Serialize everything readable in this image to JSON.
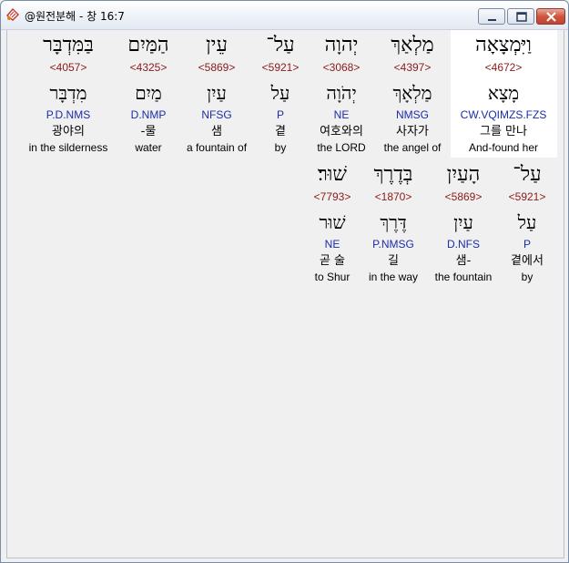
{
  "window": {
    "title": "@원전분해 - 창 16:7"
  },
  "rows": [
    {
      "words": [
        {
          "heb": "וַיִּמְצָאָה",
          "strong": "<4672>",
          "lemma": "מָצָא",
          "morph": "CW.VQIMZS.FZS",
          "kor": "그를 만나",
          "eng": "And-found her"
        },
        {
          "heb": "מַלְאַךְ",
          "strong": "<4397>",
          "lemma": "מַלְאָךְ",
          "morph": "NMSG",
          "kor": "사자가",
          "eng": "the angel of"
        },
        {
          "heb": "יְהוָה",
          "strong": "<3068>",
          "lemma": "יְהֹוָה",
          "morph": "NE",
          "kor": "여호와의",
          "eng": "the LORD"
        },
        {
          "heb": "עַל־",
          "strong": "<5921>",
          "lemma": "עַל",
          "morph": "P",
          "kor": "곁",
          "eng": "by"
        },
        {
          "heb": "עֵין",
          "strong": "<5869>",
          "lemma": "עַיִן",
          "morph": "NFSG",
          "kor": "샘",
          "eng": "a fountain of"
        },
        {
          "heb": "הַמַּיִם",
          "strong": "<4325>",
          "lemma": "מַיִם",
          "morph": "D.NMP",
          "kor": "-물",
          "eng": "water"
        },
        {
          "heb": "בַּמִּדְבָּר",
          "strong": "<4057>",
          "lemma": "מִדְבָּר",
          "morph": "P.D.NMS",
          "kor": "광야의",
          "eng": "in the silderness"
        }
      ]
    },
    {
      "words": [
        {
          "heb": "עַל־",
          "strong": "<5921>",
          "lemma": "עַל",
          "morph": "P",
          "kor": "곁에서",
          "eng": "by"
        },
        {
          "heb": "הָעַיִן",
          "strong": "<5869>",
          "lemma": "עַיִן",
          "morph": "D.NFS",
          "kor": "샘-",
          "eng": "the fountain"
        },
        {
          "heb": "בְּדֶרֶךְ",
          "strong": "<1870>",
          "lemma": "דֶּרֶךְ",
          "morph": "P.NMSG",
          "kor": "길",
          "eng": "in the way"
        },
        {
          "heb": "שׁוּר׃",
          "strong": "<7793>",
          "lemma": "שׁוּר",
          "morph": "NE",
          "kor": "곧 술",
          "eng": "to Shur"
        }
      ]
    }
  ]
}
